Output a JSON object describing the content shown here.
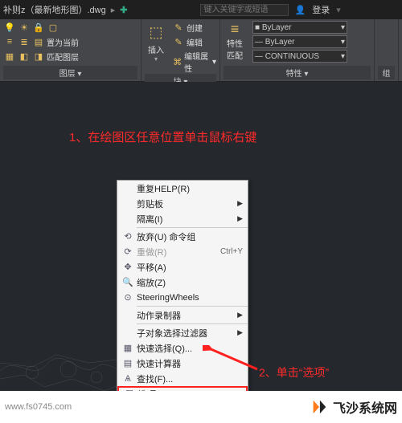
{
  "titlebar": {
    "document": "补则z（最新地形图）.dwg",
    "search_placeholder": "键入关键字或短语",
    "login": "登录"
  },
  "ribbon": {
    "layers": {
      "title": "图层",
      "set_current": "置为当前",
      "match_layer": "匹配图层"
    },
    "block": {
      "title": "块",
      "insert": "插入",
      "create": "创建",
      "edit": "编辑",
      "edit_attr": "编辑属性"
    },
    "properties": {
      "title": "特性",
      "props": "特性",
      "match": "匹配",
      "layer_dd": "ByLayer",
      "linetype_dd": "ByLayer",
      "lineweight_dd": "CONTINUOUS"
    },
    "group": {
      "title": "组"
    }
  },
  "annotations": {
    "step1": "1、在绘图区任意位置单击鼠标右键",
    "step2": "2、单击“选项”"
  },
  "contextmenu": {
    "repeat": "重复HELP(R)",
    "clipboard": "剪贴板",
    "isolate": "隔离(I)",
    "undo": "放弃(U) 命令组",
    "redo": "重做(R)",
    "redo_shortcut": "Ctrl+Y",
    "pan": "平移(A)",
    "zoom": "缩放(Z)",
    "wheels": "SteeringWheels",
    "recorder": "动作录制器",
    "subfilter": "子对象选择过滤器",
    "qselect": "快速选择(Q)...",
    "quickcalc": "快速计算器",
    "find": "查找(F)...",
    "options": "选项(O)..."
  },
  "footer": {
    "source": "www.fs0745.com",
    "brand": "飞沙系统网"
  }
}
